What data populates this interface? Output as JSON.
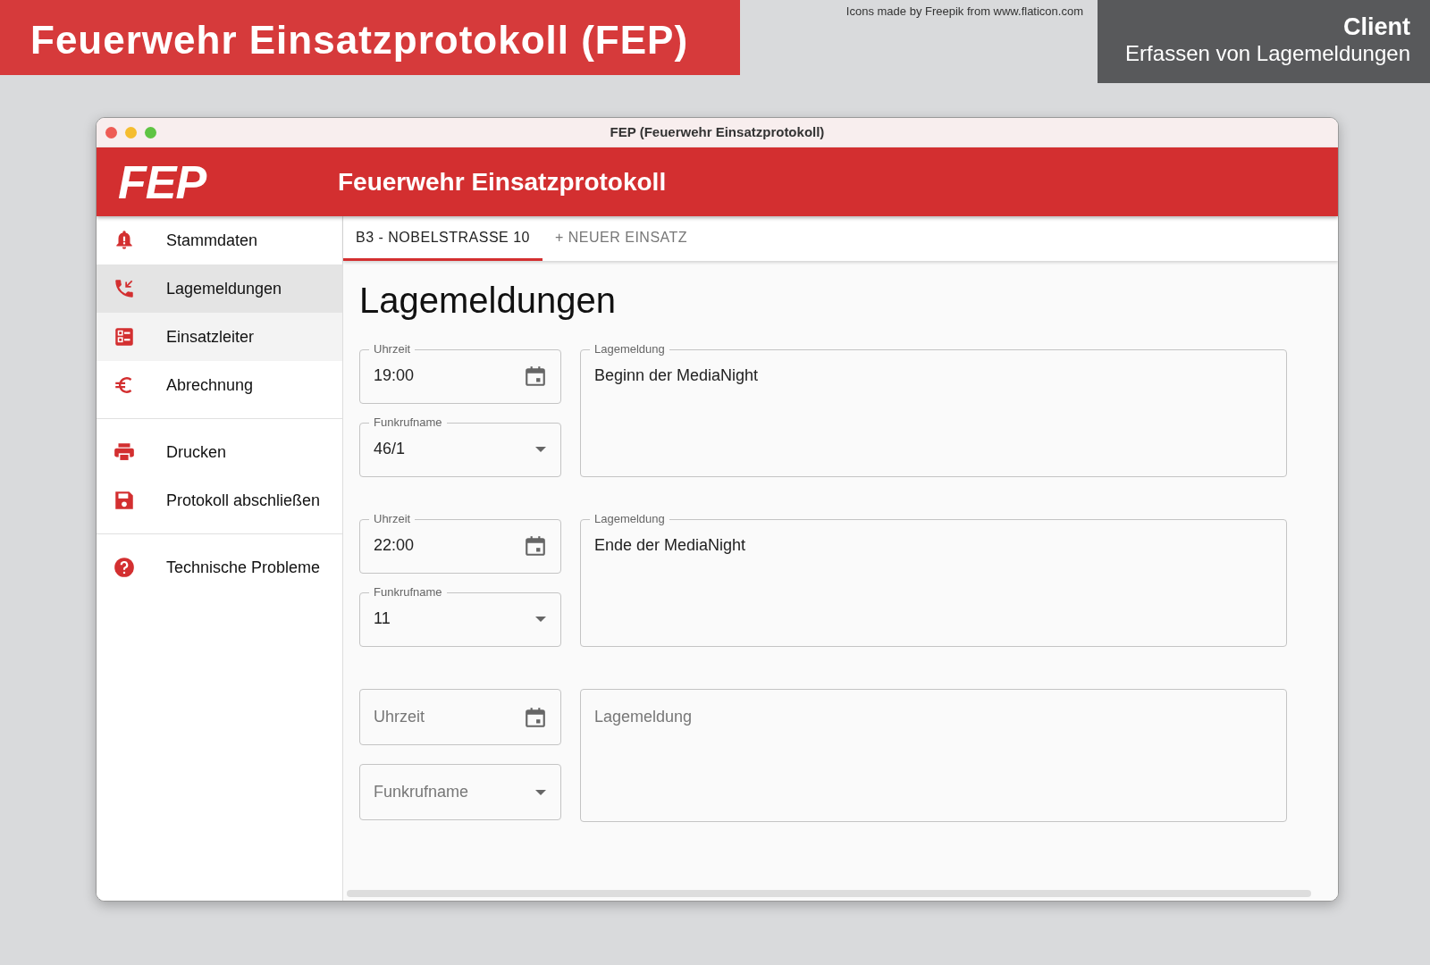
{
  "banner": {
    "title": "Feuerwehr Einsatzprotokoll (FEP)",
    "credit": "Icons made by Freepik from www.flaticon.com",
    "context_title": "Client",
    "context_subtitle": "Erfassen von Lagemeldungen"
  },
  "window": {
    "title": "FEP (Feuerwehr Einsatzprotokoll)"
  },
  "app_bar": {
    "logo": "FEP",
    "title": "Feuerwehr Einsatzprotokoll"
  },
  "sidebar": {
    "groups": [
      [
        {
          "label": "Stammdaten",
          "selected": false,
          "hovered": false
        },
        {
          "label": "Lagemeldungen",
          "selected": true,
          "hovered": false
        },
        {
          "label": "Einsatzleiter",
          "selected": false,
          "hovered": true
        },
        {
          "label": "Abrechnung",
          "selected": false,
          "hovered": false
        }
      ],
      [
        {
          "label": "Drucken",
          "selected": false,
          "hovered": false
        },
        {
          "label": "Protokoll abschließen",
          "selected": false,
          "hovered": false
        }
      ],
      [
        {
          "label": "Technische Probleme",
          "selected": false,
          "hovered": false
        }
      ]
    ]
  },
  "tabs": [
    {
      "label": "B3 - NOBELSTRASSE 10",
      "selected": true
    },
    {
      "label": "+ NEUER EINSATZ",
      "selected": false
    }
  ],
  "heading": "Lagemeldungen",
  "entries": [
    {
      "time": {
        "label": "Uhrzeit",
        "value": "19:00"
      },
      "callsign": {
        "label": "Funkrufname",
        "value": "46/1"
      },
      "message": {
        "label": "Lagemeldung",
        "value": "Beginn der MediaNight"
      }
    },
    {
      "time": {
        "label": "Uhrzeit",
        "value": "22:00"
      },
      "callsign": {
        "label": "Funkrufname",
        "value": "11"
      },
      "message": {
        "label": "Lagemeldung",
        "value": "Ende der MediaNight"
      }
    },
    {
      "time": {
        "placeholder": "Uhrzeit"
      },
      "callsign": {
        "placeholder": "Funkrufname"
      },
      "message": {
        "placeholder": "Lagemeldung"
      }
    }
  ]
}
